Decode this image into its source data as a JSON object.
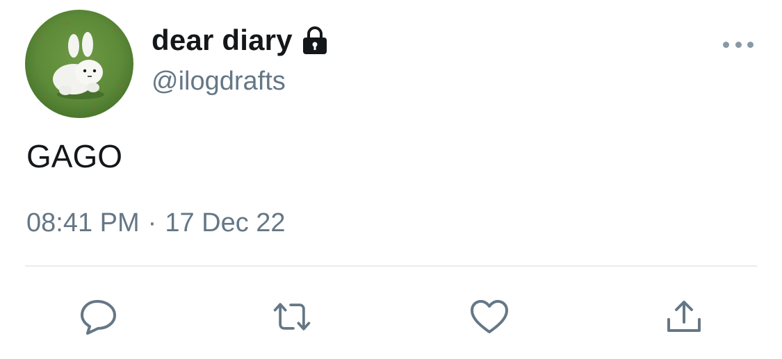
{
  "tweet": {
    "display_name": "dear diary",
    "handle": "@ilogdrafts",
    "text": "GAGO",
    "time": "08:41 PM",
    "separator": "·",
    "date": "17 Dec 22"
  },
  "icons": {
    "lock": "lock-icon",
    "more": "more-horizontal-icon",
    "reply": "reply-icon",
    "retweet": "retweet-icon",
    "like": "heart-icon",
    "share": "share-icon"
  },
  "colors": {
    "text_primary": "#14171a",
    "text_secondary": "#657786",
    "icon_gray": "#657786",
    "divider": "#e6ecf0"
  }
}
